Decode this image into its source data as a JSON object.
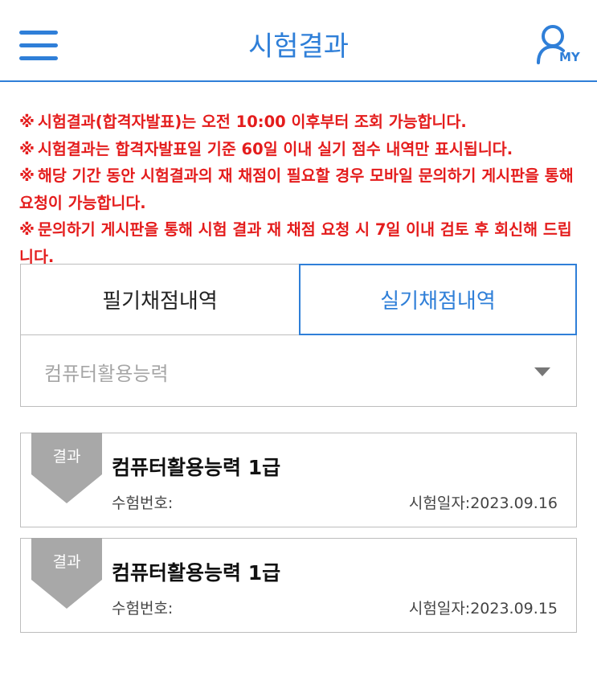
{
  "header": {
    "title": "시험결과",
    "my_label": "MY",
    "menu_icon": "hamburger-menu-icon",
    "user_icon": "user-icon",
    "accent_color": "#2f7fd8"
  },
  "notices": {
    "mark": "※",
    "color": "#e41c1c",
    "items": [
      "시험결과(합격자발표)는 오전 10:00 이후부터 조회 가능합니다.",
      "시험결과는 합격자발표일 기준 60일 이내 실기 점수 내역만 표시됩니다.",
      "해당 기간 동안 시험결과의 재 채점이 필요할 경우 모바일 문의하기 게시판을 통해 요청이 가능합니다.",
      "문의하기 게시판을 통해 시험 결과 재 채점 요청 시 7일 이내 검토 후 회신해 드립니다."
    ]
  },
  "tabs": [
    {
      "label": "필기채점내역",
      "active": false
    },
    {
      "label": "실기채점내역",
      "active": true
    }
  ],
  "select": {
    "selected": "컴퓨터활용능력"
  },
  "results": [
    {
      "badge": "결과",
      "name": "컴퓨터활용능력 1급",
      "exam_number_label": "수험번호:",
      "date_label": "시험일자:",
      "date": "2023.09.16"
    },
    {
      "badge": "결과",
      "name": "컴퓨터활용능력 1급",
      "exam_number_label": "수험번호:",
      "date_label": "시험일자:",
      "date": "2023.09.15"
    }
  ]
}
